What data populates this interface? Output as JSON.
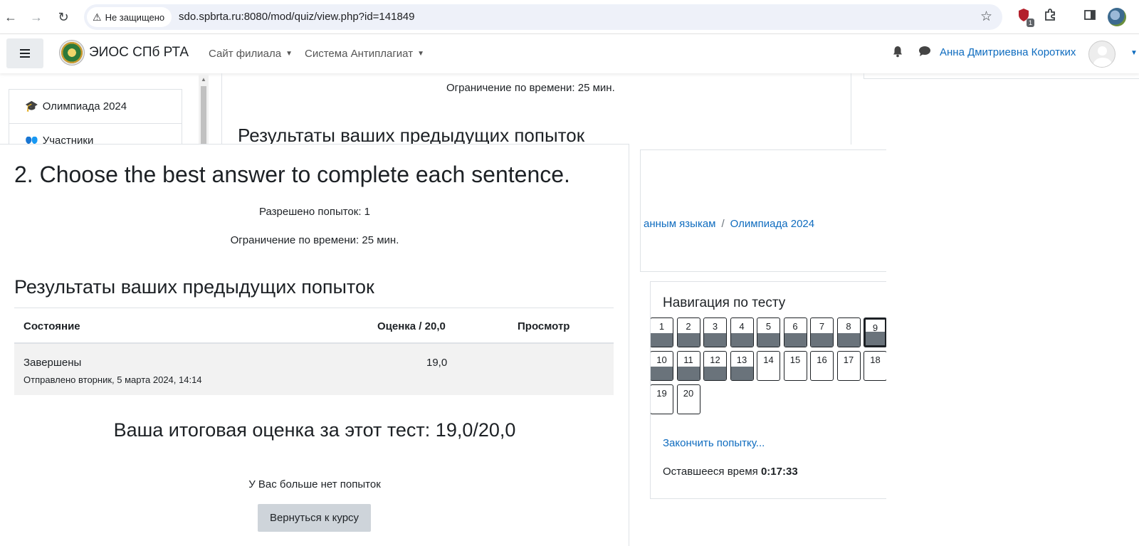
{
  "browser": {
    "security_label": "Не защищено",
    "url": "sdo.spbrta.ru:8080/mod/quiz/view.php?id=141849",
    "extension_badge": "1"
  },
  "navbar": {
    "site_name": "ЭИОС СПб РТА",
    "menus": [
      "Сайт филиала",
      "Система Антиплагиат"
    ],
    "user_name": "Анна Дмитриевна Коротких"
  },
  "background": {
    "sidebar_items": [
      "Олимпиада 2024",
      "Участники"
    ],
    "time_limit": "Ограничение по времени: 25 мин.",
    "results_heading": "Результаты ваших предыдущих попыток",
    "breadcrumbs": [
      "анным языкам",
      "Олимпиада 2024"
    ],
    "breadcrumb_separator": "/",
    "quiz_nav": {
      "title": "Навигация по тесту",
      "questions": [
        {
          "label": "1",
          "answered": true
        },
        {
          "label": "2",
          "answered": true
        },
        {
          "label": "3",
          "answered": true
        },
        {
          "label": "4",
          "answered": true
        },
        {
          "label": "5",
          "answered": true
        },
        {
          "label": "6",
          "answered": true
        },
        {
          "label": "7",
          "answered": true
        },
        {
          "label": "8",
          "answered": true
        },
        {
          "label": "9",
          "answered": true,
          "current": true
        },
        {
          "label": "10",
          "answered": true
        },
        {
          "label": "11",
          "answered": true
        },
        {
          "label": "12",
          "answered": true
        },
        {
          "label": "13",
          "answered": true
        },
        {
          "label": "14",
          "answered": false
        },
        {
          "label": "15",
          "answered": false
        },
        {
          "label": "16",
          "answered": false
        },
        {
          "label": "17",
          "answered": false
        },
        {
          "label": "18",
          "answered": false
        },
        {
          "label": "19",
          "answered": false
        },
        {
          "label": "20",
          "answered": false
        }
      ],
      "finish_link": "Закончить попытку...",
      "time_left_label": "Оставшееся время",
      "time_left_value": "0:17:33"
    }
  },
  "overlay": {
    "title": "2. Choose the best answer to complete each sentence.",
    "attempts_allowed": "Разрешено попыток: 1",
    "time_limit": "Ограничение по времени: 25 мин.",
    "results_heading": "Результаты ваших предыдущих попыток",
    "table": {
      "headers": [
        "Состояние",
        "Оценка / 20,0",
        "Просмотр"
      ],
      "rows": [
        {
          "status": "Завершены",
          "submitted": "Отправлено вторник, 5 марта 2024, 14:14",
          "grade": "19,0"
        }
      ]
    },
    "final_grade": "Ваша итоговая оценка за этот тест: 19,0/20,0",
    "no_attempts": "У Вас больше нет попыток",
    "back_button": "Вернуться к курсу"
  }
}
